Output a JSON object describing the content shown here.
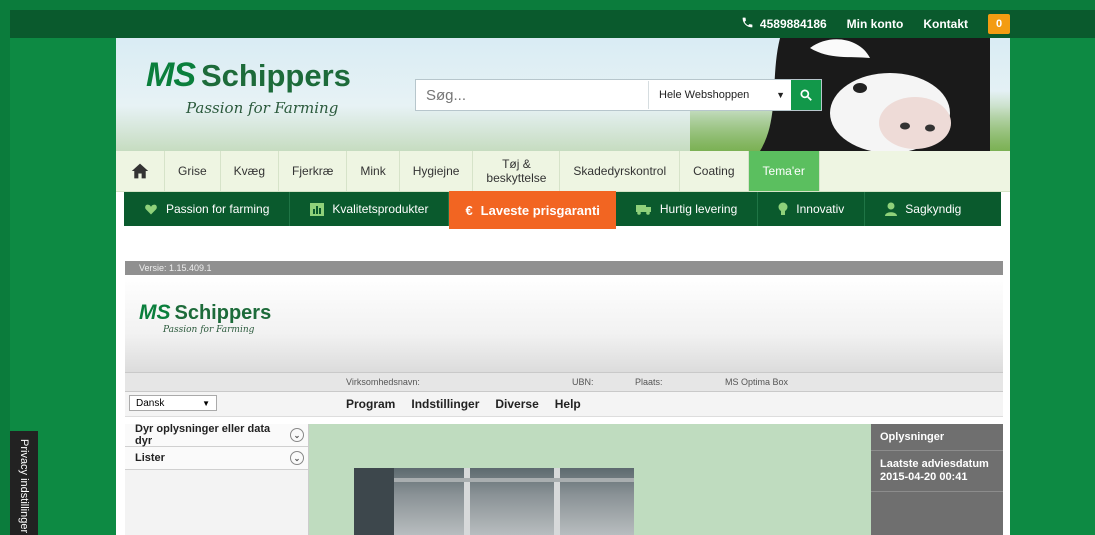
{
  "topbar": {
    "phone": "4589884186",
    "account": "Min konto",
    "contact": "Kontakt",
    "cart_count": "0"
  },
  "header": {
    "logo_ms": "MS",
    "logo_name": "Schippers",
    "tagline": "Passion for Farming",
    "search_placeholder": "Søg...",
    "search_scope": "Hele Webshoppen"
  },
  "nav": {
    "items": [
      "Grise",
      "Kvæg",
      "Fjerkræ",
      "Mink",
      "Hygiejne",
      "Tøj & beskyttelse",
      "Skadedyrskontrol",
      "Coating",
      "Tema'er"
    ]
  },
  "usp": {
    "items": [
      "Passion for farming",
      "Kvalitetsprodukter",
      "Laveste prisgaranti",
      "Hurtig levering",
      "Innovativ",
      "Sagkyndig"
    ]
  },
  "app": {
    "version": "Versie: 1.15.409.1",
    "logo_ms": "MS",
    "logo_name": "Schippers",
    "tagline": "Passion for Farming",
    "info": {
      "company_label": "Virksomhedsnavn:",
      "ubn_label": "UBN:",
      "place_label": "Plaats:",
      "product": "MS Optima Box"
    },
    "language": "Dansk",
    "menus": [
      "Program",
      "Indstillinger",
      "Diverse",
      "Help"
    ],
    "sidebar": [
      "Dyr oplysninger eller data dyr",
      "Lister"
    ],
    "right_panel": {
      "title": "Oplysninger",
      "advice_label": "Laatste adviesdatum",
      "advice_date": "2015-04-20 00:41"
    }
  },
  "privacy": "Privacy indstillinger",
  "colors": {
    "brand_green": "#0a7f3c",
    "dark_green": "#0a5a2d",
    "orange": "#f26522"
  }
}
